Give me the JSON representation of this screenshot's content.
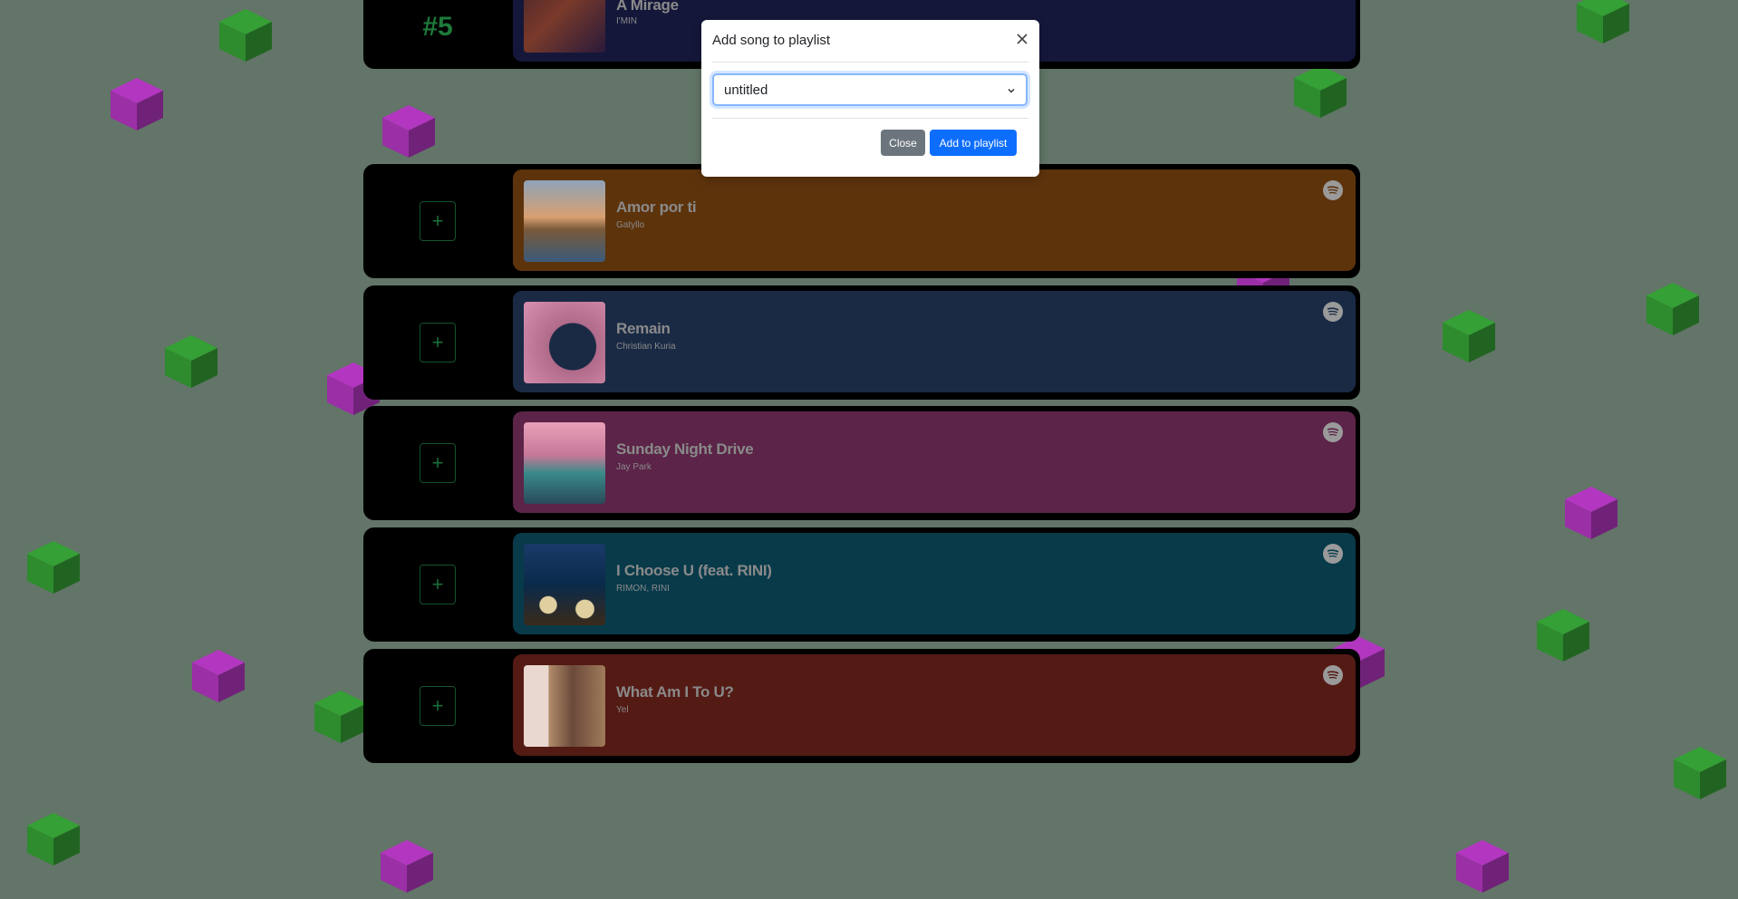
{
  "colors": {
    "background": "#627568",
    "cube_green": "#2e8b2e",
    "cube_purple": "#9b2fa6",
    "rank_green": "#1e7a3a",
    "primary_button": "#0d6efd",
    "secondary_button": "#6c757d"
  },
  "top_row": {
    "rank": "#5",
    "title": "A Mirage",
    "artist": "I'MIN",
    "card_color": "#14173a"
  },
  "songs": [
    {
      "title": "Amor por ti",
      "artist": "Gatyllo",
      "card_color": "#5d330c",
      "add_label": "+",
      "icon": "spotify-icon"
    },
    {
      "title": "Remain",
      "artist": "Christian Kuria",
      "card_color": "#1a2a44",
      "add_label": "+",
      "icon": "spotify-icon"
    },
    {
      "title": "Sunday Night Drive",
      "artist": "Jay Park",
      "card_color": "#5b2448",
      "add_label": "+",
      "icon": "spotify-icon"
    },
    {
      "title": "I Choose U (feat. RINI)",
      "artist": "RIMON, RINI",
      "card_color": "#083a4a",
      "add_label": "+",
      "icon": "spotify-icon"
    },
    {
      "title": "What Am I To U?",
      "artist": "Yel",
      "card_color": "#541a14",
      "add_label": "+",
      "icon": "spotify-icon"
    }
  ],
  "modal": {
    "title": "Add song to playlist",
    "selected_playlist": "untitled",
    "close_label": "Close",
    "add_label": "Add to playlist"
  }
}
